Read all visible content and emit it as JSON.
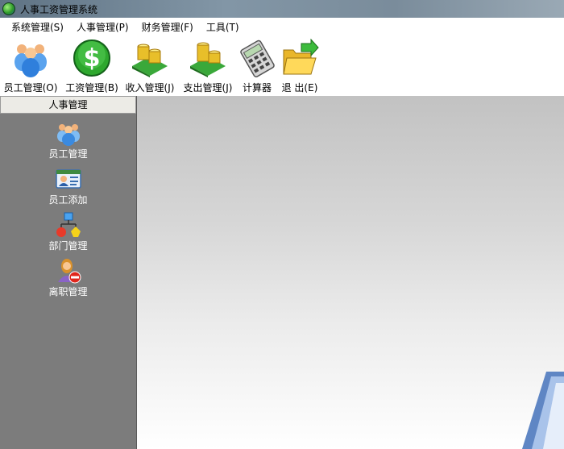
{
  "window": {
    "title": "人事工资管理系统"
  },
  "menu": {
    "items": [
      {
        "label": "系统管理(S)"
      },
      {
        "label": "人事管理(P)"
      },
      {
        "label": "财务管理(F)"
      },
      {
        "label": "工具(T)"
      }
    ]
  },
  "toolbar": {
    "items": [
      {
        "label": "员工管理(O)",
        "icon": "users-icon"
      },
      {
        "label": "工资管理(B)",
        "icon": "dollar-icon"
      },
      {
        "label": "收入管理(J)",
        "icon": "coins-in-icon"
      },
      {
        "label": "支出管理(J)",
        "icon": "coins-out-icon"
      },
      {
        "label": "计算器",
        "icon": "calculator-icon"
      },
      {
        "label": "退 出(E)",
        "icon": "exit-folder-icon"
      }
    ]
  },
  "sidebar": {
    "header": "人事管理",
    "items": [
      {
        "label": "员工管理",
        "icon": "users-icon"
      },
      {
        "label": "员工添加",
        "icon": "id-card-icon"
      },
      {
        "label": "部门管理",
        "icon": "org-chart-icon"
      },
      {
        "label": "离职管理",
        "icon": "user-remove-icon"
      }
    ]
  },
  "colors": {
    "sidebar_bg": "#7c7c7c",
    "sidebar_text": "#ffffff",
    "main_gradient_top": "#c2c2c2",
    "main_gradient_bottom": "#ffffff"
  }
}
